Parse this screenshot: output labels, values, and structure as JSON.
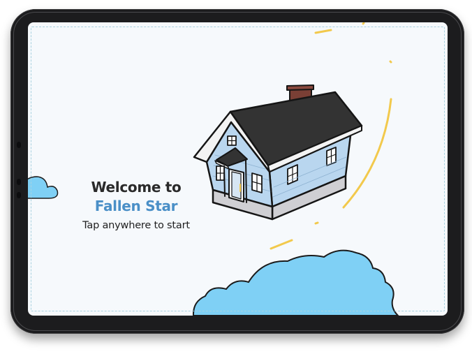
{
  "screen": {
    "title_line1": "Welcome to",
    "title_line2": "Fallen Star",
    "prompt": "Tap anywhere to start"
  },
  "colors": {
    "background": "#f6f9fc",
    "title": "#2a2a2a",
    "brand": "#4a8fc7",
    "cloud": "#7fd0f5",
    "house_wall": "#b9d6ef",
    "roof": "#333333",
    "chimney": "#7a3f35",
    "motion_trail": "#f2c94c"
  },
  "icons": {
    "house": "house-illustration",
    "cloud": "cloud-icon",
    "trail": "motion-trail"
  }
}
